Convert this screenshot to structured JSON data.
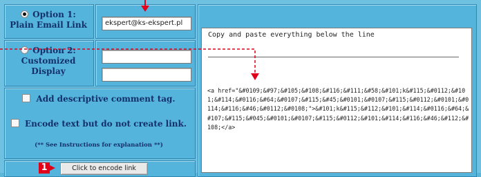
{
  "options": {
    "option1": {
      "label_line1": "Option 1:",
      "label_line2": "Plain Email Link",
      "email_value": "ekspert@ks-ekspert.pl",
      "selected": true
    },
    "option2": {
      "label_line1": "Option 2:",
      "label_line2": "Customized",
      "label_line3": "Display",
      "selected": false
    }
  },
  "checkboxes": {
    "comment_tag": "Add descriptive comment tag.",
    "encode_text": "Encode text but do not create link."
  },
  "note": "(** See Instructions for explanation **)",
  "button": {
    "label": "Click to encode link",
    "step_badge": "1"
  },
  "output": {
    "header": "Copy and paste everything below the line",
    "code": "<a href=\"&#0109;&#97;&#105;&#108;&#116;&#111;&#58;&#101;k&#115;&#0112;&#101;&#114;&#0116;&#64;&#0107;&#115;&#45;&#0101;&#0107;&#115;&#0112;&#0101;&#0114;&#116;&#46;&#0112;&#0108;\">&#101;k&#115;&#112;&#101;&#114;&#0116;&#64;&#107;&#115;&#045;&#0101;&#0107;&#115;&#0112;&#101;&#114;&#116;&#46;&#112;&#108;</a>"
  },
  "colors": {
    "panel": "#55b4dc",
    "label_text": "#13306a",
    "arrow": "#e1001a"
  }
}
